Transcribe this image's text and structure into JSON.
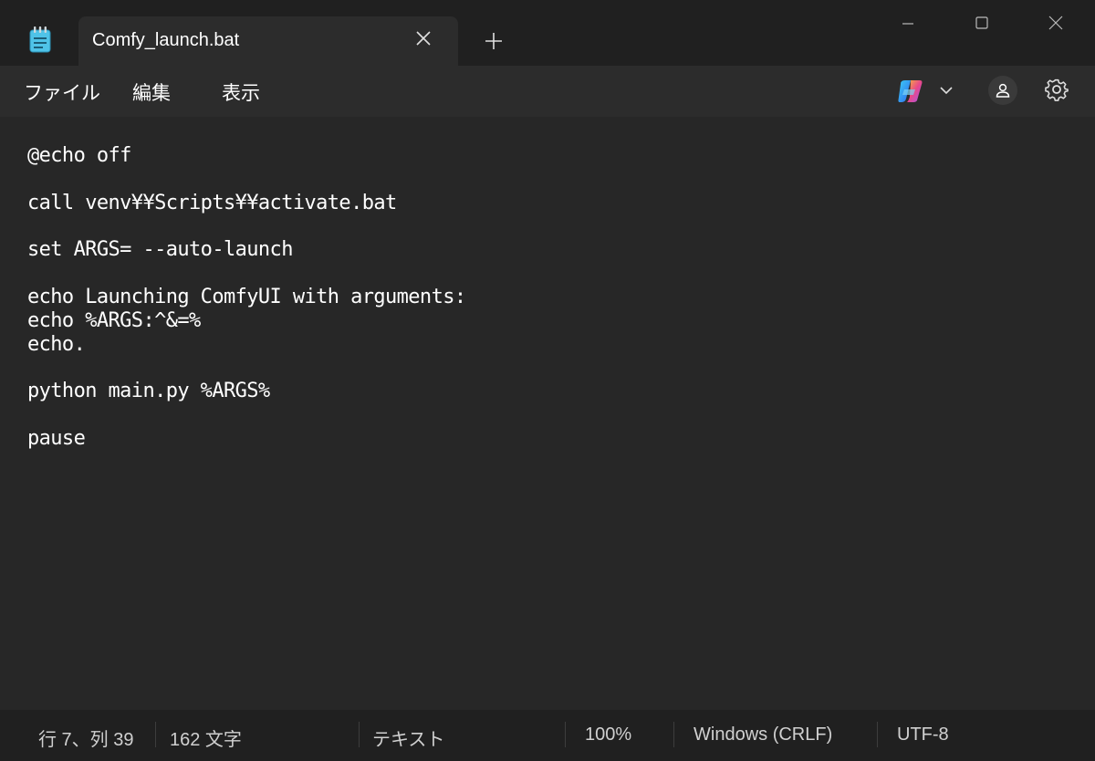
{
  "window": {
    "tab_title": "Comfy_launch.bat"
  },
  "menu": {
    "file": "ファイル",
    "edit": "編集",
    "view": "表示"
  },
  "toolbar_icons": [
    "copilot-icon",
    "chevron-down-icon",
    "account-icon",
    "settings-gear-icon"
  ],
  "editor": {
    "lines": [
      "@echo off",
      "",
      "call venv¥¥Scripts¥¥activate.bat",
      "",
      "set ARGS= --auto-launch",
      "",
      "echo Launching ComfyUI with arguments:",
      "echo %ARGS:^&=%",
      "echo.",
      "",
      "python main.py %ARGS%",
      "",
      "pause"
    ]
  },
  "status": {
    "position": "行 7、列 39",
    "char_count": "162 文字",
    "format": "テキスト",
    "zoom": "100%",
    "line_ending": "Windows (CRLF)",
    "encoding": "UTF-8"
  },
  "colors": {
    "background": "#202020",
    "editor_bg": "#272727",
    "app_icon": "#4fc3e8"
  }
}
